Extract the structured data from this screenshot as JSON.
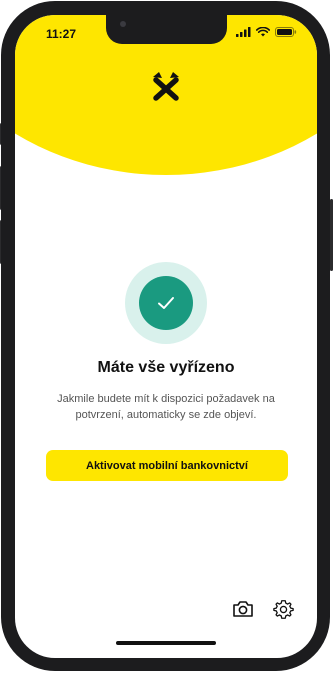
{
  "status_bar": {
    "time": "11:27"
  },
  "main": {
    "title": "Máte vše vyřízeno",
    "description": "Jakmile budete mít k dispozici požadavek na potvrzení, automaticky se zde objeví.",
    "cta_label": "Aktivovat mobilní bankovnictví"
  },
  "icons": {
    "logo": "raiffeisen-logo",
    "check": "check-icon",
    "camera": "camera-icon",
    "settings": "gear-icon"
  },
  "colors": {
    "brand_yellow": "#fee600",
    "check_green": "#1a9a80",
    "check_halo": "#d9f1ec"
  }
}
